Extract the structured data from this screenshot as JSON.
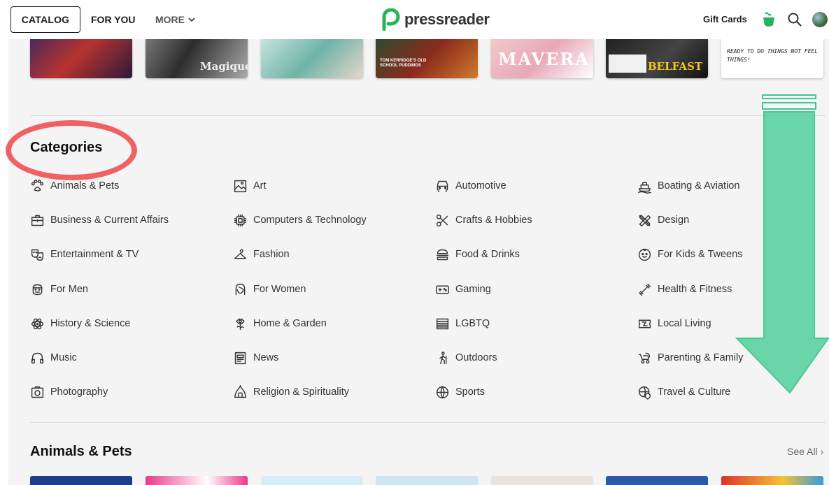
{
  "topbar": {
    "catalog_label": "CATALOG",
    "for_you_label": "FOR YOU",
    "more_label": "MORE",
    "logo_text": "pressreader",
    "gift_cards_label": "Gift Cards",
    "cup_icon": "coffee-cup-icon",
    "search_icon": "search-icon",
    "globe_icon": "globe-icon"
  },
  "thumbnails_top": [
    {
      "caption": ""
    },
    {
      "caption": "Magique"
    },
    {
      "caption": ""
    },
    {
      "caption": "TOM KERRIDGE'S OLD SCHOOL PUDDINGS"
    },
    {
      "caption": "MAVERA"
    },
    {
      "caption": "BELFAST"
    },
    {
      "caption": "READY TO DO THINGS NOT FEEL THINGS!"
    }
  ],
  "categories_section": {
    "title": "Categories",
    "items": [
      {
        "label": "Animals & Pets",
        "icon": "paw-icon"
      },
      {
        "label": "Art",
        "icon": "art-icon"
      },
      {
        "label": "Automotive",
        "icon": "car-icon"
      },
      {
        "label": "Boating & Aviation",
        "icon": "ship-icon"
      },
      {
        "label": "Business & Current Affairs",
        "icon": "briefcase-icon"
      },
      {
        "label": "Computers & Technology",
        "icon": "chip-icon"
      },
      {
        "label": "Crafts & Hobbies",
        "icon": "scissors-icon"
      },
      {
        "label": "Design",
        "icon": "design-tools-icon"
      },
      {
        "label": "Entertainment & TV",
        "icon": "masks-icon"
      },
      {
        "label": "Fashion",
        "icon": "hanger-icon"
      },
      {
        "label": "Food & Drinks",
        "icon": "burger-icon"
      },
      {
        "label": "For Kids & Tweens",
        "icon": "kid-face-icon"
      },
      {
        "label": "For Men",
        "icon": "man-face-icon"
      },
      {
        "label": "For Women",
        "icon": "woman-face-icon"
      },
      {
        "label": "Gaming",
        "icon": "gamepad-icon"
      },
      {
        "label": "Health & Fitness",
        "icon": "dumbbell-icon"
      },
      {
        "label": "History & Science",
        "icon": "atom-icon"
      },
      {
        "label": "Home & Garden",
        "icon": "flower-icon"
      },
      {
        "label": "LGBTQ",
        "icon": "stripes-icon"
      },
      {
        "label": "Local Living",
        "icon": "ticket-icon"
      },
      {
        "label": "Music",
        "icon": "headphones-icon"
      },
      {
        "label": "News",
        "icon": "newspaper-icon"
      },
      {
        "label": "Outdoors",
        "icon": "hiker-icon"
      },
      {
        "label": "Parenting & Family",
        "icon": "stroller-icon"
      },
      {
        "label": "Photography",
        "icon": "camera-icon"
      },
      {
        "label": "Religion & Spirituality",
        "icon": "temple-icon"
      },
      {
        "label": "Sports",
        "icon": "ball-icon"
      },
      {
        "label": "Travel & Culture",
        "icon": "globe-pin-icon"
      }
    ]
  },
  "animals_section": {
    "title": "Animals & Pets",
    "see_all_label": "See All"
  },
  "annotations": {
    "circle_color": "#f06262",
    "arrow_color": "#5fd3a4"
  }
}
